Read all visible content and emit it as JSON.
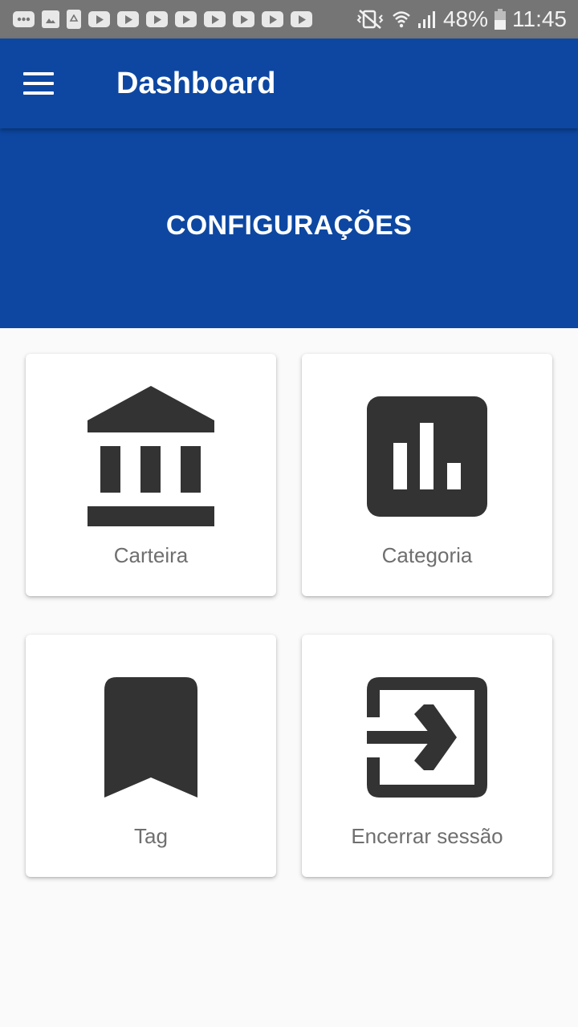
{
  "status_bar": {
    "battery_percent": "48%",
    "time": "11:45",
    "notification_icons": [
      "message-icon",
      "image-icon",
      "recycle-icon",
      "youtube-icon",
      "youtube-icon",
      "youtube-icon",
      "youtube-icon",
      "youtube-icon",
      "youtube-icon",
      "youtube-icon",
      "youtube-icon"
    ],
    "system_icons": [
      "vibrate-mute-icon",
      "wifi-icon",
      "signal-icon",
      "battery-icon"
    ]
  },
  "app_bar": {
    "title": "Dashboard",
    "menu_icon": "hamburger-menu-icon",
    "background": "#0d47a1"
  },
  "banner": {
    "title": "CONFIGURAÇÕES"
  },
  "cards": [
    {
      "label": "Carteira",
      "icon": "bank-icon"
    },
    {
      "label": "Categoria",
      "icon": "bar-chart-icon"
    },
    {
      "label": "Tag",
      "icon": "bookmark-icon"
    },
    {
      "label": "Encerrar sessão",
      "icon": "exit-icon"
    }
  ],
  "colors": {
    "primary": "#0d47a1",
    "icon": "#333333",
    "label": "#6f6f6f",
    "status_bar": "#757575"
  }
}
